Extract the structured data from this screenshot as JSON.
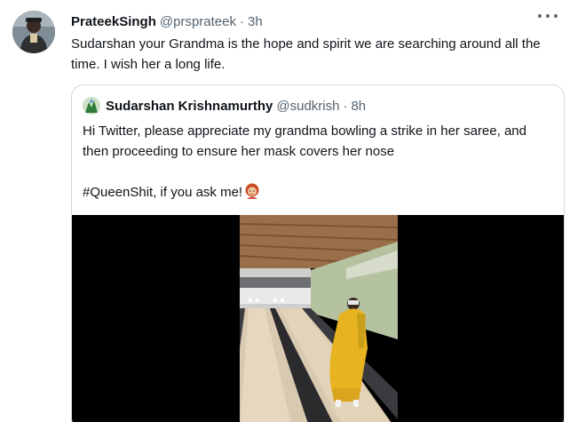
{
  "tweet": {
    "author_name": "PrateekSingh",
    "handle": "@prsprateek",
    "separator": "·",
    "time": "3h",
    "text": "Sudarshan your Grandma is the hope and spirit we are searching around all the time. I wish her a long life.",
    "more_icon": "more-options-icon"
  },
  "quoted_tweet": {
    "author_name": "Sudarshan Krishnamurthy",
    "handle": "@sudkrish",
    "separator": "·",
    "time": "8h",
    "text_line1": "Hi Twitter, please appreciate my grandma bowling a strike in her saree, and then proceeding to ensure her mask covers her nose",
    "text_line2": "#QueenShit, if you ask me!",
    "emoji": "woman-red-hair-emoji",
    "media": "video-thumbnail"
  },
  "colors": {
    "text": "#0f1419",
    "secondary": "#536471",
    "border": "#cfd9de",
    "saree": "#e8b321"
  }
}
